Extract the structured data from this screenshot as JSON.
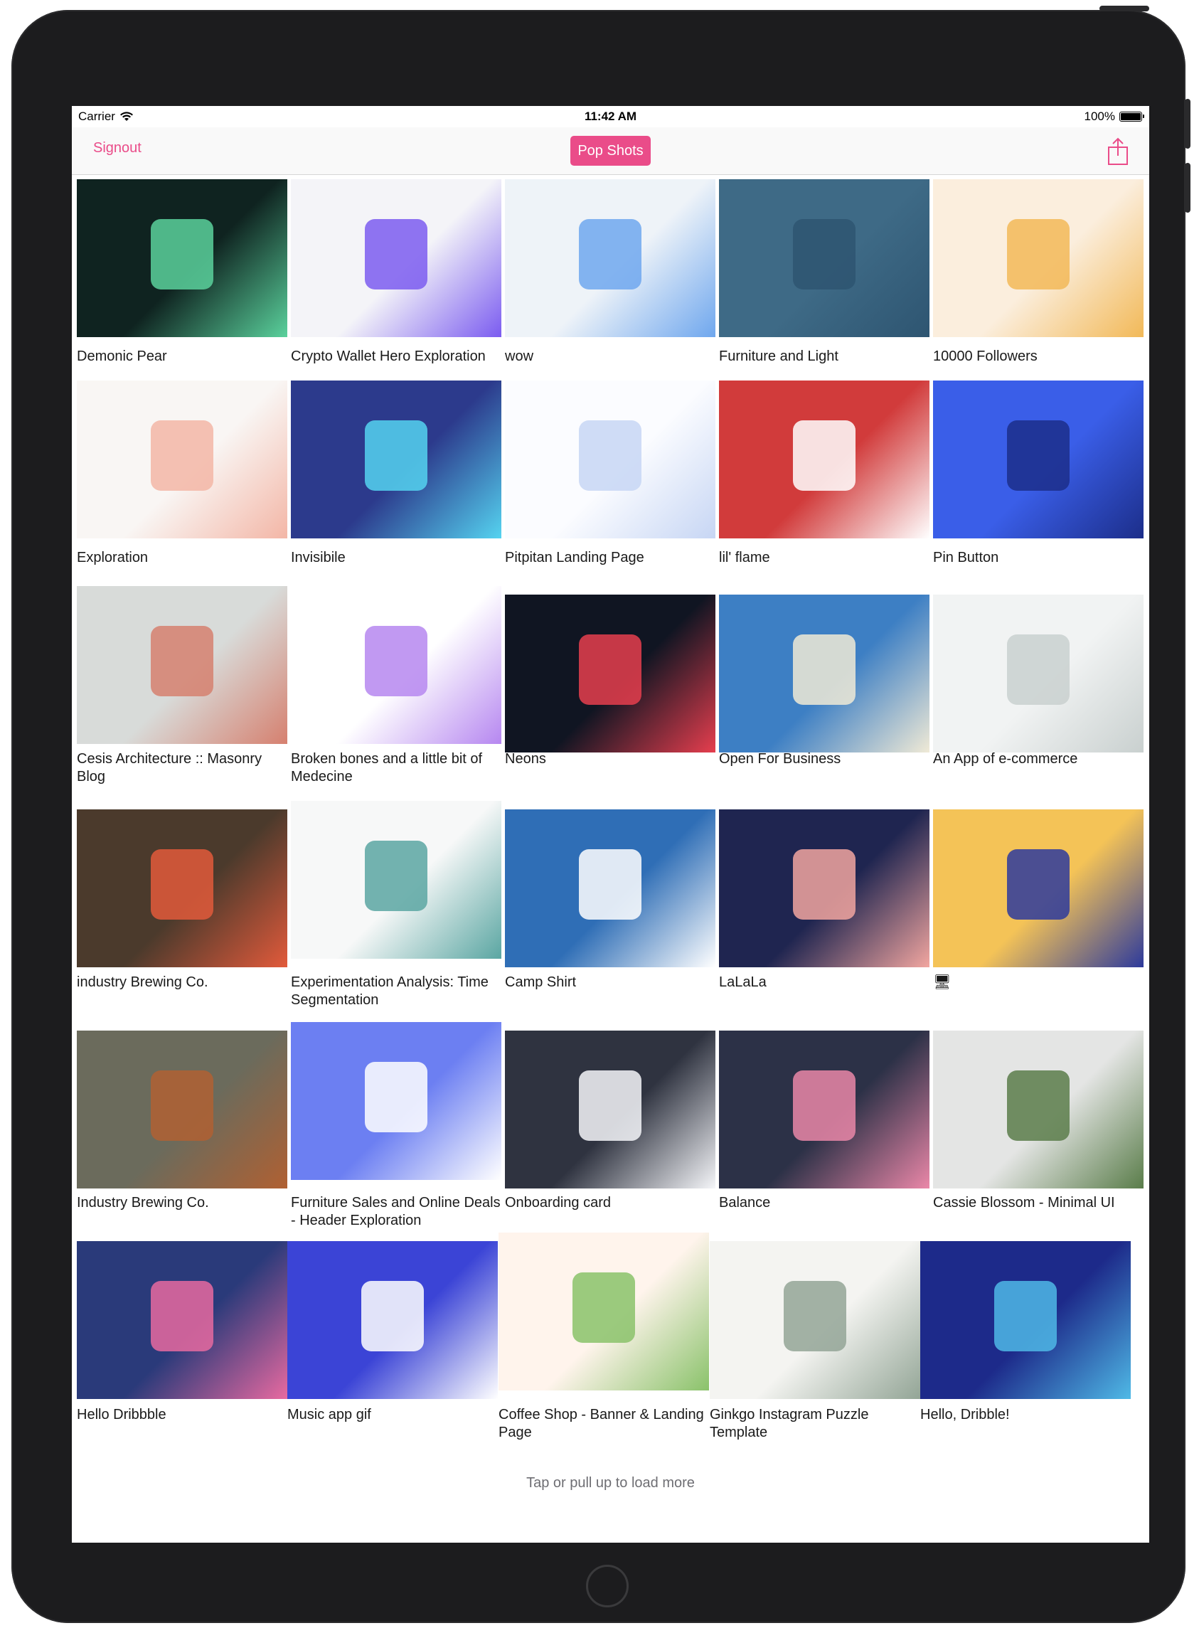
{
  "status_bar": {
    "carrier": "Carrier",
    "time": "11:42 AM",
    "battery": "100%"
  },
  "navbar": {
    "signout_label": "Signout",
    "title": "Pop Shots",
    "share_icon": "share-icon"
  },
  "shots": [
    {
      "title": "Demonic Pear",
      "colors": [
        "#0f2320",
        "#5ad19c"
      ]
    },
    {
      "title": "Crypto Wallet Hero Exploration",
      "colors": [
        "#f4f4f8",
        "#7b5cf0"
      ]
    },
    {
      "title": "wow",
      "colors": [
        "#eef3f8",
        "#6fa7ee"
      ]
    },
    {
      "title": "Furniture and Light",
      "colors": [
        "#3e6a86",
        "#2e5571"
      ]
    },
    {
      "title": "10000  Followers",
      "colors": [
        "#fbeedd",
        "#f2b958"
      ]
    },
    {
      "title": "Exploration",
      "colors": [
        "#f9f6f4",
        "#f3b6a6"
      ]
    },
    {
      "title": "Invisibile",
      "colors": [
        "#2c3a8c",
        "#55d3f0"
      ]
    },
    {
      "title": "Pitpitan Landing Page",
      "colors": [
        "#fbfcff",
        "#c7d6f4"
      ]
    },
    {
      "title": "lil' flame",
      "colors": [
        "#d13b3b",
        "#ffffff"
      ]
    },
    {
      "title": "Pin Button",
      "colors": [
        "#3a5ee8",
        "#1c2e8a"
      ]
    },
    {
      "title": "Cesis Architecture :: Masonry Blog",
      "colors": [
        "#d8dbd9",
        "#d6806f"
      ]
    },
    {
      "title": "Broken bones and a little bit of Medecine",
      "colors": [
        "#ffffff",
        "#b687f0"
      ]
    },
    {
      "title": "Neons",
      "colors": [
        "#101522",
        "#e63e4e"
      ]
    },
    {
      "title": "Open For Business",
      "colors": [
        "#3d7fc4",
        "#f0ead6"
      ]
    },
    {
      "title": "An App of e-commerce",
      "colors": [
        "#f1f3f3",
        "#c9d0cf"
      ]
    },
    {
      "title": "industry Brewing Co.",
      "colors": [
        "#4b3a2c",
        "#e25a3b"
      ]
    },
    {
      "title": "Experimentation Analysis: Time Segmentation",
      "colors": [
        "#f7f8f8",
        "#5aa6a2"
      ]
    },
    {
      "title": "Camp Shirt",
      "colors": [
        "#2f6eb6",
        "#ffffff"
      ]
    },
    {
      "title": "LaLaLa",
      "colors": [
        "#1f2550",
        "#f2a6a0"
      ]
    },
    {
      "title": "🖥",
      "colors": [
        "#f4c357",
        "#2d3a9c"
      ]
    },
    {
      "title": "Industry Brewing Co.",
      "colors": [
        "#6b6b5c",
        "#b06032"
      ]
    },
    {
      "title": "Furniture Sales and Online Deals - Header Exploration",
      "colors": [
        "#6c7ff2",
        "#ffffff"
      ]
    },
    {
      "title": "Onboarding card",
      "colors": [
        "#2f3340",
        "#f5f6f9"
      ]
    },
    {
      "title": "Balance",
      "colors": [
        "#2c3147",
        "#ea87a8"
      ]
    },
    {
      "title": "Cassie Blossom - Minimal UI",
      "colors": [
        "#e4e5e4",
        "#5a7d4a"
      ]
    },
    {
      "title": "Hello Dribbble",
      "colors": [
        "#2a3a7a",
        "#e86aa0"
      ]
    },
    {
      "title": "Music app gif",
      "colors": [
        "#3b44d6",
        "#ffffff"
      ]
    },
    {
      "title": "Coffee Shop - Banner & Landing Page",
      "colors": [
        "#fff4ec",
        "#8ac26a"
      ]
    },
    {
      "title": "Ginkgo Instagram Puzzle Template",
      "colors": [
        "#f4f4f1",
        "#93a596"
      ]
    },
    {
      "title": "Hello, Dribble!",
      "colors": [
        "#1d2a8a",
        "#4fb9e6"
      ]
    }
  ],
  "load_more": "Tap or pull up to load more"
}
